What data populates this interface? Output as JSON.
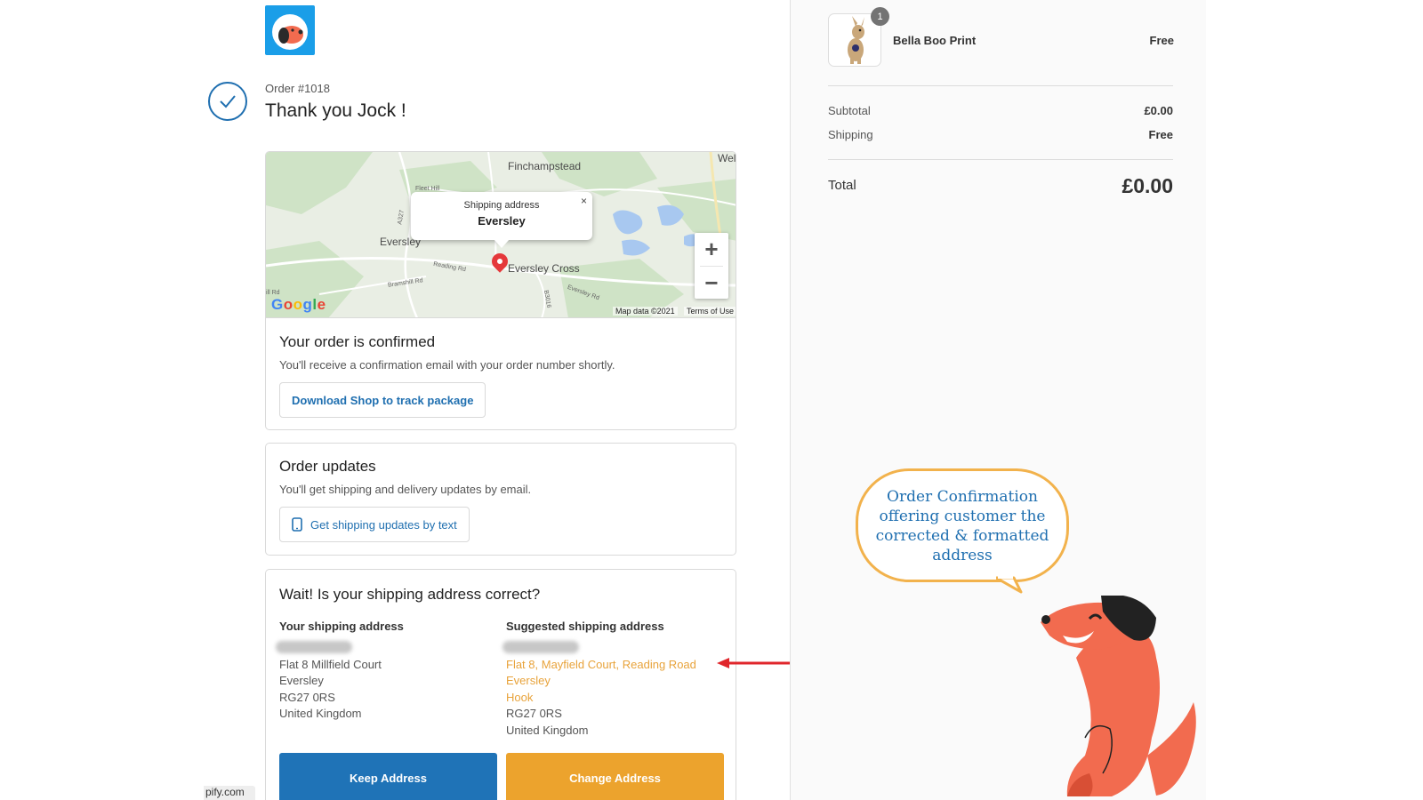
{
  "order": {
    "number": "Order #1018",
    "thanks": "Thank you Jock !"
  },
  "map": {
    "places": {
      "finchampstead": "Finchampstead",
      "eversley": "Eversley",
      "eversley_cross": "Eversley Cross",
      "wel": "Wel"
    },
    "roads": {
      "fleet_hill": "Fleet Hill",
      "a327": "A327",
      "reading_rd": "Reading Rd",
      "bramshill_rd": "Bramshill Rd",
      "b3016": "B3016",
      "eversley_rd": "Eversley Rd",
      "hill_rd": "ill Rd"
    },
    "popup": {
      "title": "Shipping address",
      "place": "Eversley",
      "close": "×"
    },
    "zoom_in": "+",
    "zoom_out": "−",
    "google": [
      "G",
      "o",
      "o",
      "g",
      "l",
      "e"
    ],
    "google_colors": [
      "#4285f4",
      "#ea4335",
      "#fbbc05",
      "#4285f4",
      "#34a853",
      "#ea4335"
    ],
    "map_data": "Map data ©2021",
    "terms": "Terms of Use"
  },
  "confirmed": {
    "title": "Your order is confirmed",
    "text": "You'll receive a confirmation email with your order number shortly.",
    "button": "Download Shop to track package"
  },
  "updates": {
    "title": "Order updates",
    "text": "You'll get shipping and delivery updates by email.",
    "button": "Get shipping updates by text",
    "button_icon": "phone-icon"
  },
  "address": {
    "title": "Wait! Is your shipping address correct?",
    "yours": {
      "heading": "Your shipping address",
      "lines": [
        "Flat 8 Millfield Court",
        "Eversley",
        "RG27 0RS",
        "United Kingdom"
      ]
    },
    "suggested": {
      "heading": "Suggested shipping address",
      "lines": [
        "Flat 8, Mayfield Court, Reading Road",
        "Eversley",
        "Hook",
        "RG27 0RS",
        "United Kingdom"
      ]
    },
    "keep_button": "Keep Address",
    "change_button": "Change Address"
  },
  "status_url": "pify.com",
  "summary": {
    "item": {
      "name": "Bella Boo Print",
      "price": "Free",
      "quantity": "1"
    },
    "subtotal_label": "Subtotal",
    "subtotal_value": "£0.00",
    "shipping_label": "Shipping",
    "shipping_value": "Free",
    "total_label": "Total",
    "total_value": "£0.00"
  },
  "annotation": {
    "text": [
      "Order Confirmation",
      "offering customer the",
      "corrected & formatted",
      "address"
    ]
  },
  "colors": {
    "primary_blue": "#1f73b7",
    "accent_orange": "#eca32d",
    "highlight_orange": "#e8a33b",
    "dog_orange": "#f26b4f",
    "arrow_red": "#e0262b"
  }
}
